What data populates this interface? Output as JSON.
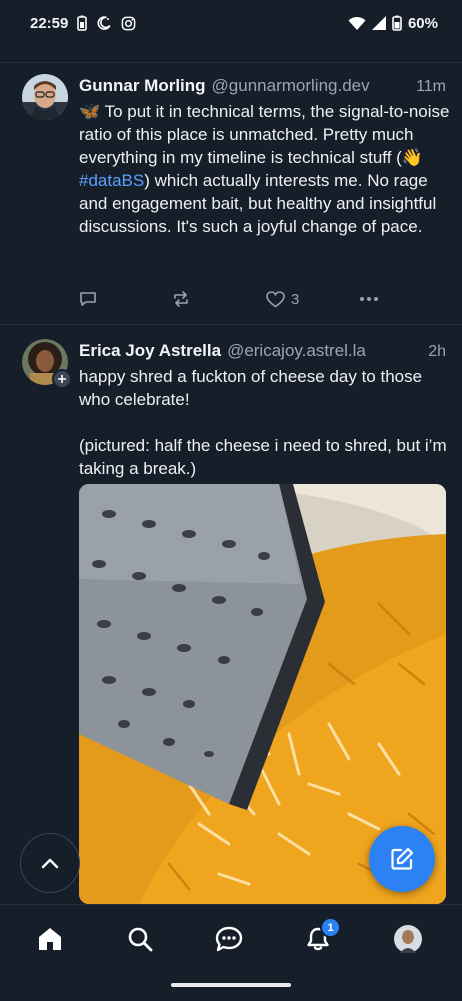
{
  "status_bar": {
    "time": "22:59",
    "battery": "60%"
  },
  "posts": [
    {
      "display_name": "Gunnar Morling",
      "handle": "@gunnarmorling.dev",
      "time": "11m",
      "body": {
        "before_hashtag": "🦋 To put it in technical terms, the signal-to-noise ratio of this place is unmatched. Pretty much everything in my timeline is technical stuff (👋 ",
        "hashtag": "#dataBS",
        "after_hashtag": ") which actually interests me. No rage and engagement bait, but healthy and insightful discussions. It's such a joyful change of pace."
      },
      "like_count": "3"
    },
    {
      "display_name": "Erica Joy Astrella",
      "handle": "@ericajoy.astrel.la",
      "time": "2h",
      "body": {
        "para1": "happy shred a fuckton of cheese day to those who celebrate!",
        "para2": "(pictured: half the cheese i need to shred, but i’m taking a break.)"
      }
    }
  ],
  "notifications_badge": "1",
  "colors": {
    "background": "#161e2a",
    "accent": "#2c82f5",
    "hashtag": "#5aa0ff",
    "muted_text": "#9aa4b4"
  },
  "icons": {
    "nav": [
      "home-icon",
      "search-icon",
      "chat-icon",
      "bell-icon",
      "profile-avatar"
    ],
    "actions": [
      "reply-icon",
      "repost-icon",
      "heart-icon",
      "more-icon"
    ]
  }
}
